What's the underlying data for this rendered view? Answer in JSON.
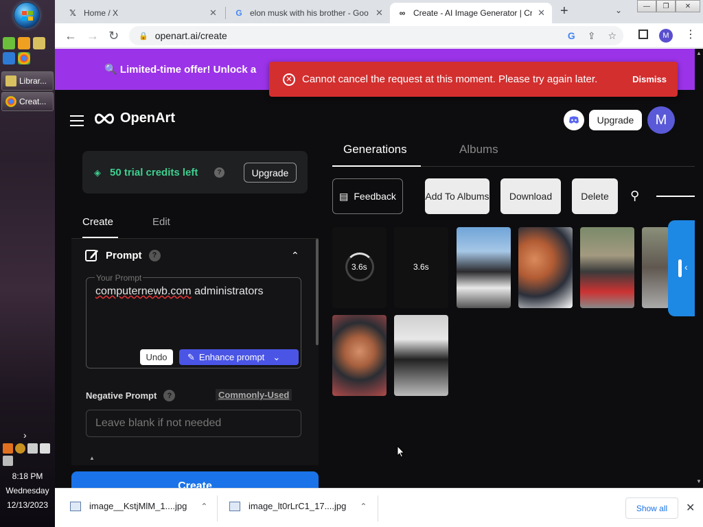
{
  "taskbar": {
    "items": [
      {
        "label": "Librar..."
      },
      {
        "label": "Creat..."
      }
    ],
    "clock": {
      "time": "8:18 PM",
      "day": "Wednesday",
      "date": "12/13/2023"
    }
  },
  "browser": {
    "tabs": [
      {
        "title": "Home / X"
      },
      {
        "title": "elon musk with his brother - Goo"
      },
      {
        "title": "Create - AI Image Generator | Cre"
      }
    ],
    "url": "openart.ai/create",
    "profile_initial": "M"
  },
  "promo": {
    "text": "🔍 Limited-time offer! Unlock a"
  },
  "toast": {
    "message": "Cannot cancel the request at this moment. Please try again later.",
    "dismiss": "Dismiss"
  },
  "header": {
    "logo": "OpenArt",
    "upgrade": "Upgrade",
    "avatar": "M"
  },
  "credits": {
    "label": "50 trial credits left",
    "upgrade": "Upgrade"
  },
  "left_tabs": [
    "Create",
    "Edit"
  ],
  "prompt": {
    "title": "Prompt",
    "legend": "Your Prompt",
    "value_word1": "computernewb.com",
    "value_word2": " administrators",
    "undo": "Undo",
    "enhance": "Enhance prompt"
  },
  "negative": {
    "label": "Negative Prompt",
    "common": "Commonly-Used",
    "placeholder": "Leave blank if not needed"
  },
  "create_button": "Create",
  "right_tabs": [
    "Generations",
    "Albums"
  ],
  "actions": {
    "feedback": "Feedback",
    "add_to_albums": "Add To Albums",
    "download": "Download",
    "delete": "Delete"
  },
  "spinners": [
    "3.6s",
    "3.6s"
  ],
  "downloads": [
    {
      "name": "image__KstjMlM_1....jpg"
    },
    {
      "name": "image_lt0rLrC1_17....jpg"
    }
  ],
  "shelf": {
    "show_all": "Show all"
  }
}
